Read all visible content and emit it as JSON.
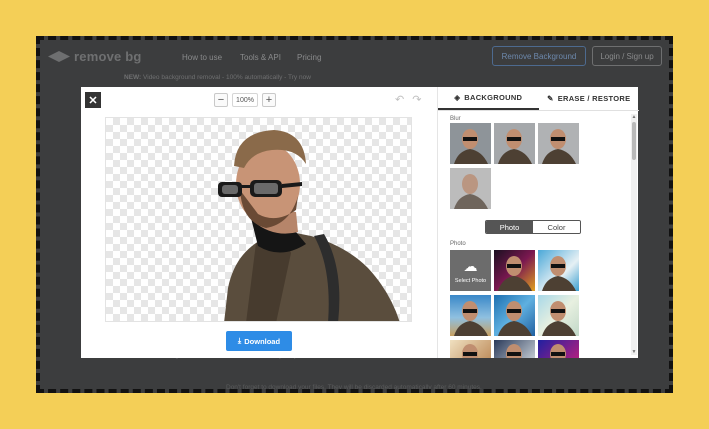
{
  "site": {
    "logo_text": "remove bg",
    "nav": [
      "How to use",
      "Tools & API",
      "Pricing"
    ],
    "remove_background_button": "Remove Background",
    "login_button": "Login / Sign up",
    "announcement_bold": "NEW:",
    "announcement": "Video background removal - 100% automatically - Try now",
    "footnote": "Don't forget to download your files. They will be discarded automatically after 60 minutes."
  },
  "editor": {
    "close_label": "✕",
    "zoom_out_label": "−",
    "zoom_value": "100%",
    "zoom_in_label": "+",
    "undo_label": "↶",
    "redo_label": "↷",
    "download_label": "Download"
  },
  "panel": {
    "tabs": [
      {
        "label": "BACKGROUND",
        "icon": "layers-icon",
        "active": true
      },
      {
        "label": "ERASE / RESTORE",
        "icon": "brush-icon",
        "active": false
      }
    ],
    "blur_label": "Blur",
    "photo_color_toggle": {
      "photo": "Photo",
      "color": "Color",
      "selected": "Photo"
    },
    "photo_label": "Photo",
    "select_photo_label": "Select Photo"
  }
}
